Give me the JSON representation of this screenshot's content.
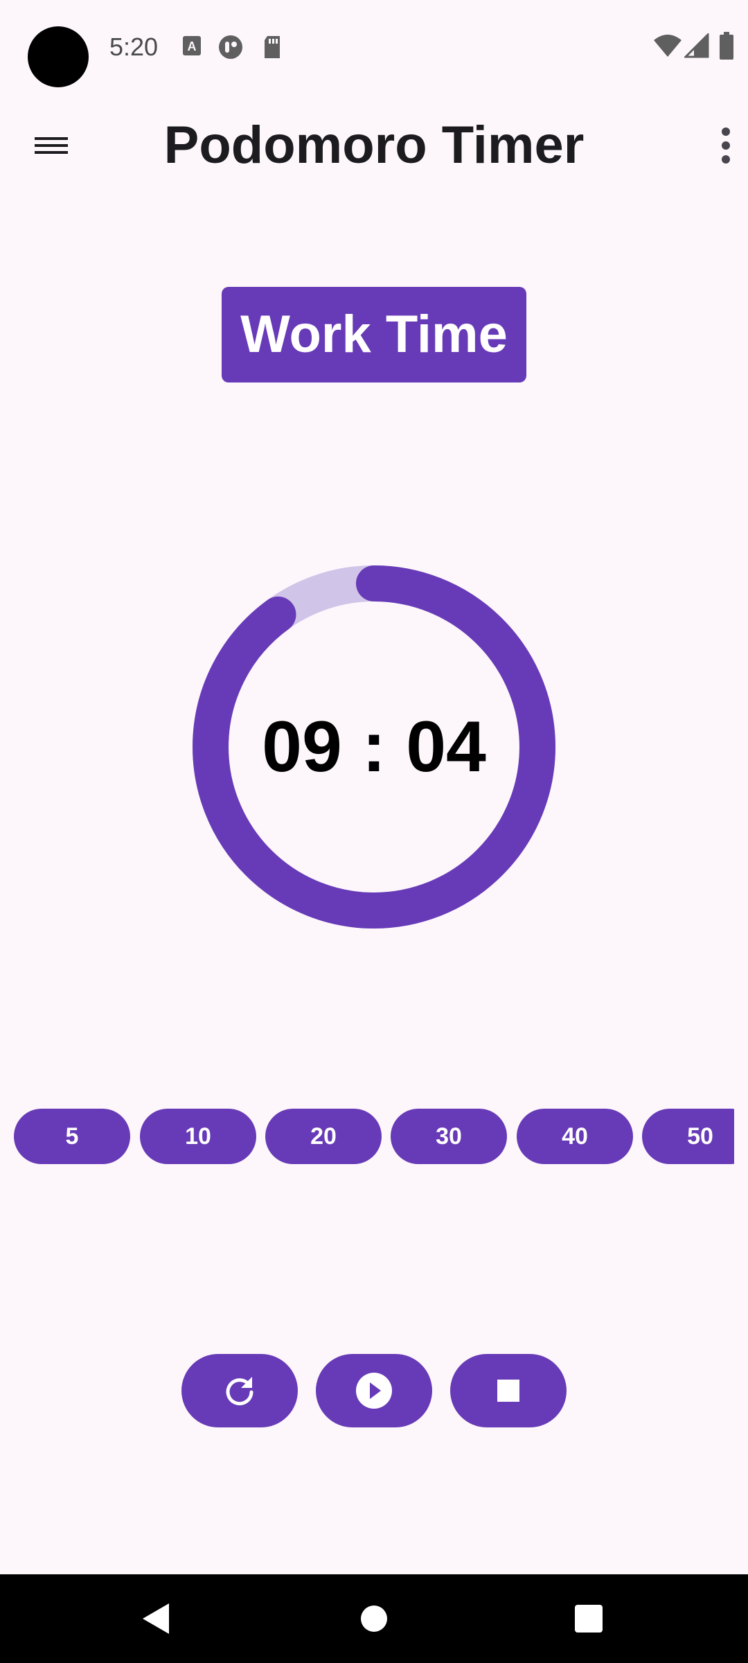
{
  "status_bar": {
    "time": "5:20",
    "left_icons": [
      "keyboard-a-icon",
      "app-notification-icon",
      "sd-card-icon"
    ],
    "right_icons": [
      "wifi-icon",
      "cellular-signal-icon",
      "battery-icon"
    ]
  },
  "app_bar": {
    "title": "Podomoro Timer",
    "menu_icon": "hamburger-menu-icon",
    "overflow_icon": "more-vert-icon"
  },
  "mode_label": "Work Time",
  "timer": {
    "display": "09 : 04",
    "progress_remaining": 0.9,
    "track_color": "#d1c4e9",
    "progress_color": "#673ab7"
  },
  "presets": [
    "5",
    "10",
    "20",
    "30",
    "40",
    "50"
  ],
  "controls": {
    "reset_icon": "refresh-icon",
    "play_icon": "play-circle-icon",
    "stop_icon": "stop-icon"
  },
  "nav_bar": {
    "back_icon": "back-triangle-icon",
    "home_icon": "home-circle-icon",
    "recents_icon": "recents-square-icon"
  },
  "colors": {
    "accent": "#673ab7",
    "background": "#fdf7fb",
    "title_text": "#1c1b1f"
  }
}
